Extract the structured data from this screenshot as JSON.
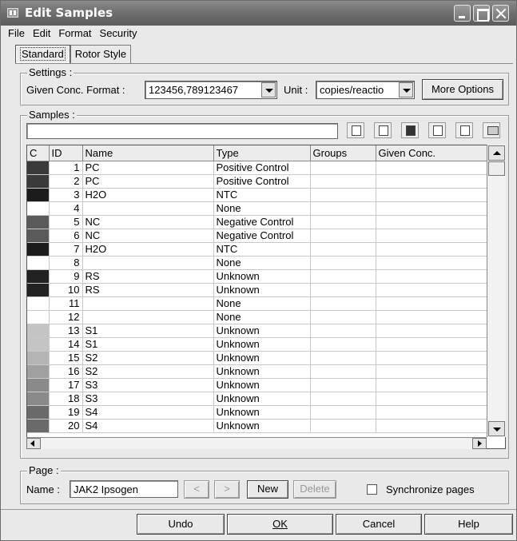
{
  "window": {
    "title": "Edit Samples"
  },
  "menu": [
    "File",
    "Edit",
    "Format",
    "Security"
  ],
  "tabs": [
    "Standard",
    "Rotor Style"
  ],
  "settings": {
    "title": "Settings :",
    "format_label": "Given Conc. Format :",
    "format_value": "123456,789123467",
    "unit_label": "Unit :",
    "unit_value": "copies/reactio",
    "more_options": "More Options"
  },
  "samples": {
    "title": "Samples :",
    "toolbar_icons": [
      "new-icon",
      "open-icon",
      "save-icon",
      "copy-icon",
      "paste-icon",
      "delete-icon"
    ],
    "columns": [
      "C",
      "ID",
      "Name",
      "Type",
      "Groups",
      "Given Conc."
    ],
    "rows": [
      {
        "color": "#3a3a3a",
        "id": "1",
        "name": "PC",
        "type": "Positive Control"
      },
      {
        "color": "#3a3a3a",
        "id": "2",
        "name": "PC",
        "type": "Positive Control"
      },
      {
        "color": "#1c1c1c",
        "id": "3",
        "name": "H2O",
        "type": "NTC"
      },
      {
        "color": "#ffffff",
        "id": "4",
        "name": "",
        "type": "None"
      },
      {
        "color": "#5a5a5a",
        "id": "5",
        "name": "NC",
        "type": "Negative Control"
      },
      {
        "color": "#5a5a5a",
        "id": "6",
        "name": "NC",
        "type": "Negative Control"
      },
      {
        "color": "#1c1c1c",
        "id": "7",
        "name": "H2O",
        "type": "NTC"
      },
      {
        "color": "#ffffff",
        "id": "8",
        "name": "",
        "type": "None"
      },
      {
        "color": "#222222",
        "id": "9",
        "name": "RS",
        "type": "Unknown"
      },
      {
        "color": "#222222",
        "id": "10",
        "name": "RS",
        "type": "Unknown"
      },
      {
        "color": "#ffffff",
        "id": "11",
        "name": "",
        "type": "None"
      },
      {
        "color": "#ffffff",
        "id": "12",
        "name": "",
        "type": "None"
      },
      {
        "color": "#c4c4c4",
        "id": "13",
        "name": "S1",
        "type": "Unknown"
      },
      {
        "color": "#c4c4c4",
        "id": "14",
        "name": "S1",
        "type": "Unknown"
      },
      {
        "color": "#b4b4b4",
        "id": "15",
        "name": "S2",
        "type": "Unknown"
      },
      {
        "color": "#a0a0a0",
        "id": "16",
        "name": "S2",
        "type": "Unknown"
      },
      {
        "color": "#8a8a8a",
        "id": "17",
        "name": "S3",
        "type": "Unknown"
      },
      {
        "color": "#8a8a8a",
        "id": "18",
        "name": "S3",
        "type": "Unknown"
      },
      {
        "color": "#6a6a6a",
        "id": "19",
        "name": "S4",
        "type": "Unknown"
      },
      {
        "color": "#6a6a6a",
        "id": "20",
        "name": "S4",
        "type": "Unknown"
      }
    ]
  },
  "page": {
    "title": "Page :",
    "name_label": "Name :",
    "name_value": "JAK2 Ipsogen",
    "prev": "<",
    "next": ">",
    "new": "New",
    "delete": "Delete",
    "sync_label": "Synchronize pages"
  },
  "footer": {
    "undo": "Undo",
    "ok": "OK",
    "cancel": "Cancel",
    "help": "Help"
  }
}
